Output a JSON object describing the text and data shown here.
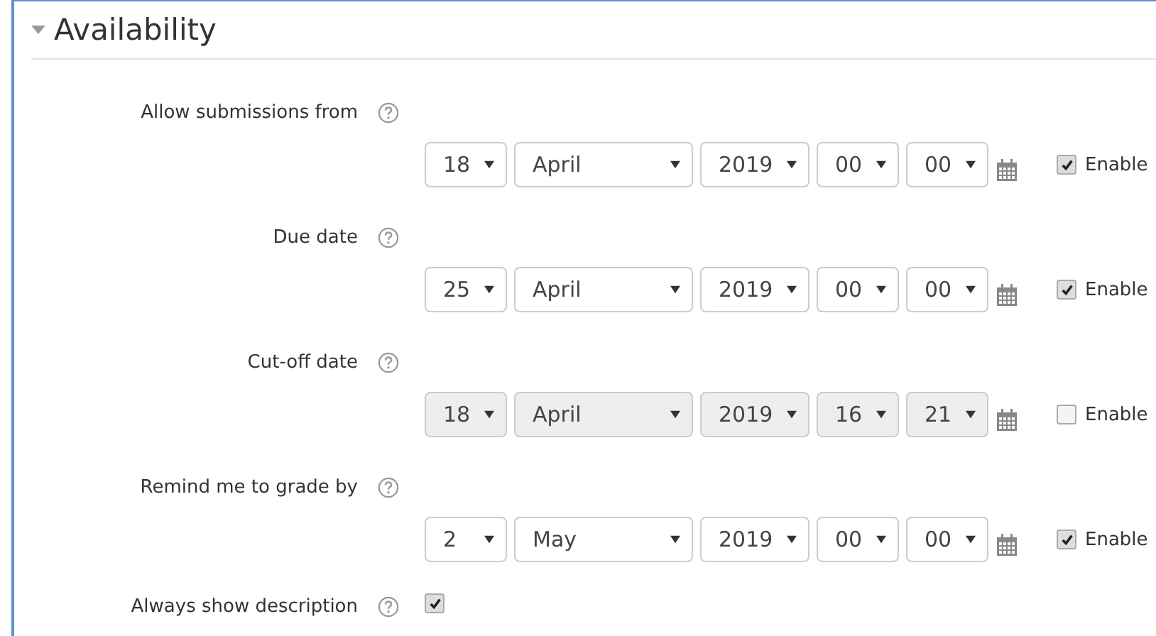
{
  "section": {
    "title": "Availability",
    "expanded": true
  },
  "dates": [
    {
      "label": "Allow submissions from",
      "day": "18",
      "month": "April",
      "year": "2019",
      "hour": "00",
      "minute": "00",
      "enable_label": "Enable",
      "enabled": true
    },
    {
      "label": "Due date",
      "day": "25",
      "month": "April",
      "year": "2019",
      "hour": "00",
      "minute": "00",
      "enable_label": "Enable",
      "enabled": true
    },
    {
      "label": "Cut-off date",
      "day": "18",
      "month": "April",
      "year": "2019",
      "hour": "16",
      "minute": "21",
      "enable_label": "Enable",
      "enabled": false
    },
    {
      "label": "Remind me to grade by",
      "day": "2",
      "month": "May",
      "year": "2019",
      "hour": "00",
      "minute": "00",
      "enable_label": "Enable",
      "enabled": true
    }
  ],
  "always_show_description": {
    "label": "Always show description",
    "checked": true
  }
}
